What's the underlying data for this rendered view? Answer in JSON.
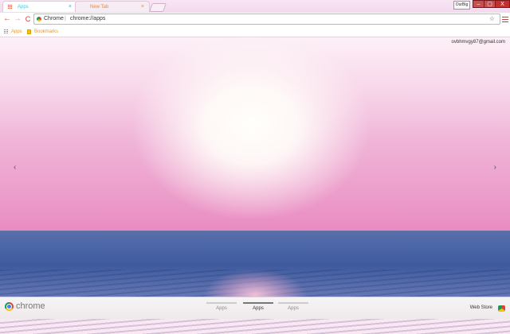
{
  "tabs": [
    {
      "title": "Apps",
      "active": true
    },
    {
      "title": "New Tab",
      "active": false
    }
  ],
  "window": {
    "profile_label": "OurBig",
    "minimize": "–",
    "maximize": "▢",
    "close": "X"
  },
  "toolbar": {
    "back": "←",
    "forward": "→",
    "reload": "C",
    "omnibox": {
      "chip": "Chrome",
      "separator": "|",
      "url": "chrome://apps"
    },
    "star": "☆"
  },
  "bookmarks": [
    {
      "label": "Apps"
    },
    {
      "label": "Bookmarks"
    }
  ],
  "user": {
    "email": "ovbhmvgy87@gmail.com"
  },
  "nav": {
    "prev": "‹",
    "next": "›"
  },
  "footer": {
    "brand": "chrome",
    "pages": [
      "Apps",
      "Apps",
      "Apps"
    ],
    "active_page_index": 1,
    "webstore_label": "Web Store"
  }
}
